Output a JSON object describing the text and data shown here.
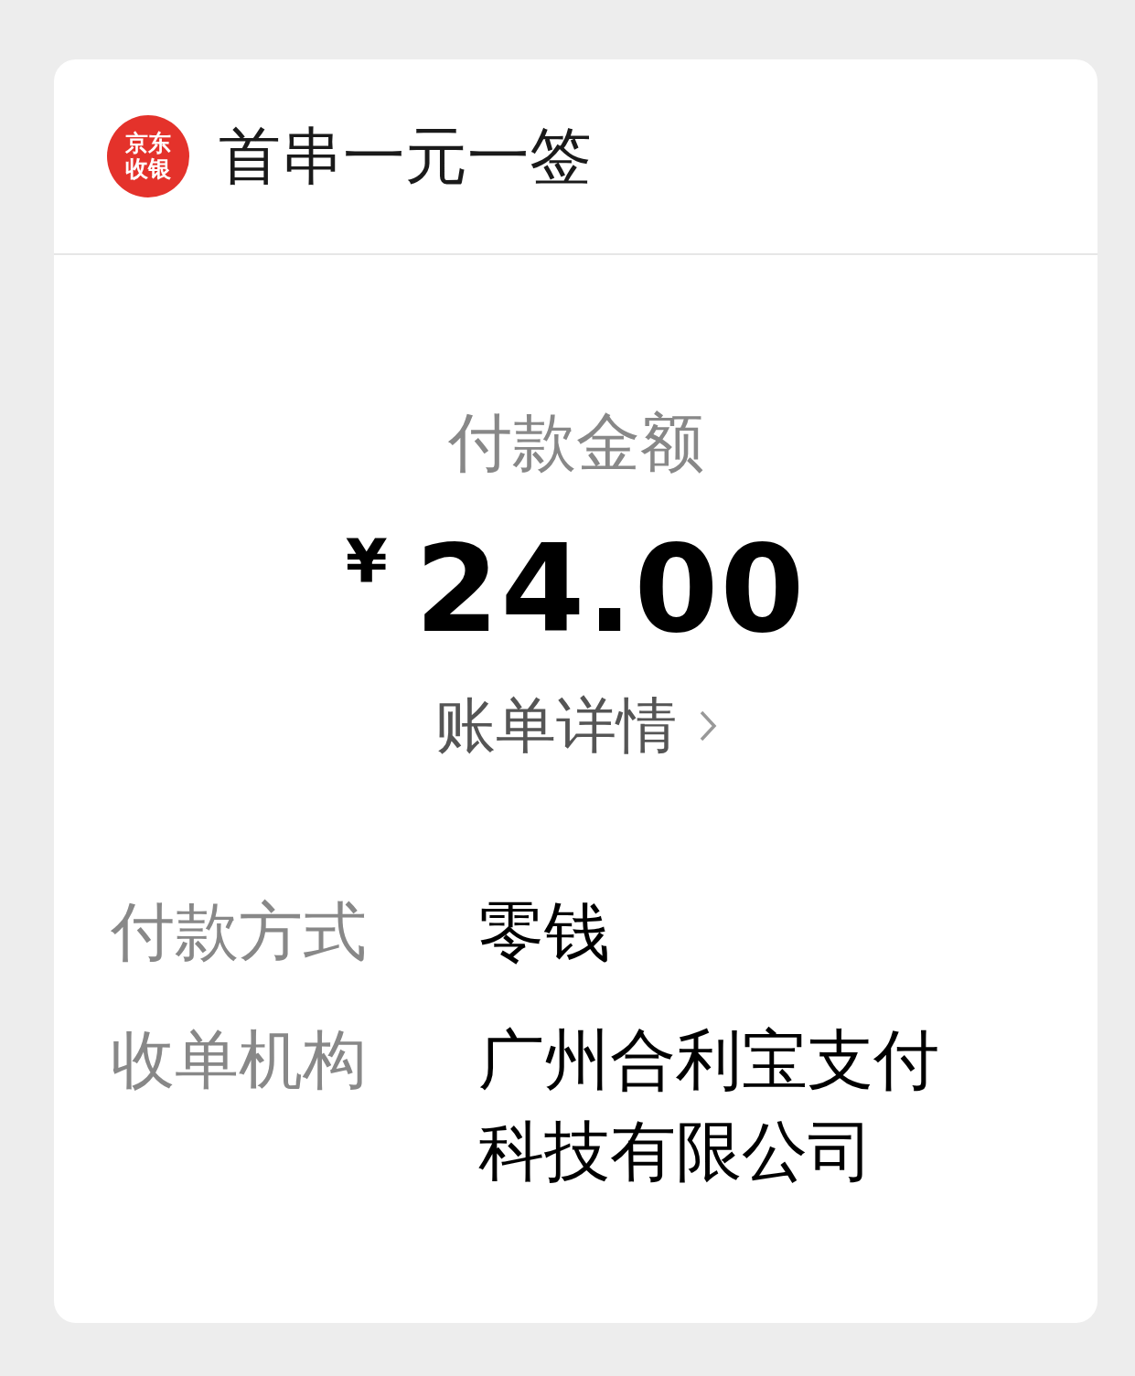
{
  "header": {
    "logo_lines": [
      "京东",
      "收银"
    ],
    "title": "首串一元一签"
  },
  "payment": {
    "label": "付款金额",
    "currency": "¥",
    "amount": "24.00",
    "details_link": "账单详情"
  },
  "rows": [
    {
      "label": "付款方式",
      "value": "零钱"
    },
    {
      "label": "收单机构",
      "value": "广州合利宝支付科技有限公司"
    }
  ]
}
